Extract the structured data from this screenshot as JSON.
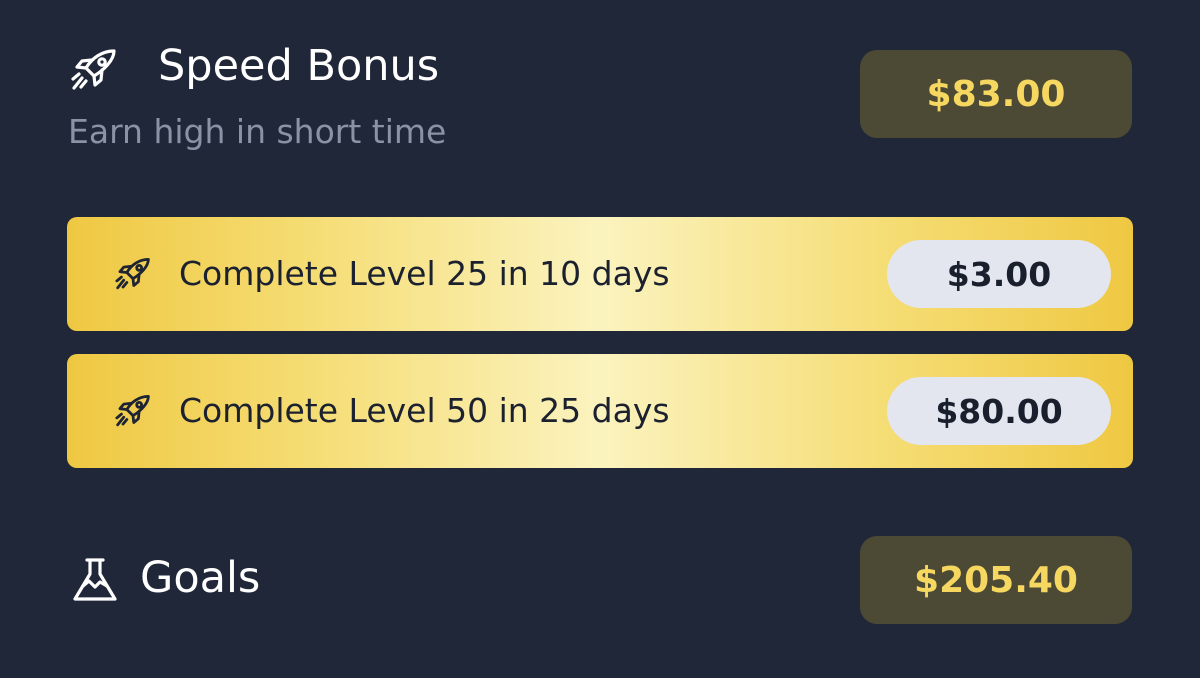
{
  "speed_bonus": {
    "icon": "rocket-icon",
    "title": "Speed Bonus",
    "subtitle": "Earn high in short time",
    "total": "$83.00"
  },
  "tasks": [
    {
      "icon": "rocket-icon",
      "label": "Complete Level 25 in 10 days",
      "reward": "$3.00"
    },
    {
      "icon": "rocket-icon",
      "label": "Complete Level 50 in 25 days",
      "reward": "$80.00"
    }
  ],
  "goals": {
    "icon": "flask-icon",
    "title": "Goals",
    "total": "$205.40"
  },
  "colors": {
    "background": "#1f2738",
    "accent_yellow": "#f6d760",
    "badge_background": "#4c4a34",
    "card_gold": "#efc842",
    "card_highlight": "#fbf3bf",
    "reward_pill": "#e3e6ef",
    "subtitle_gray": "#8b92a6"
  }
}
